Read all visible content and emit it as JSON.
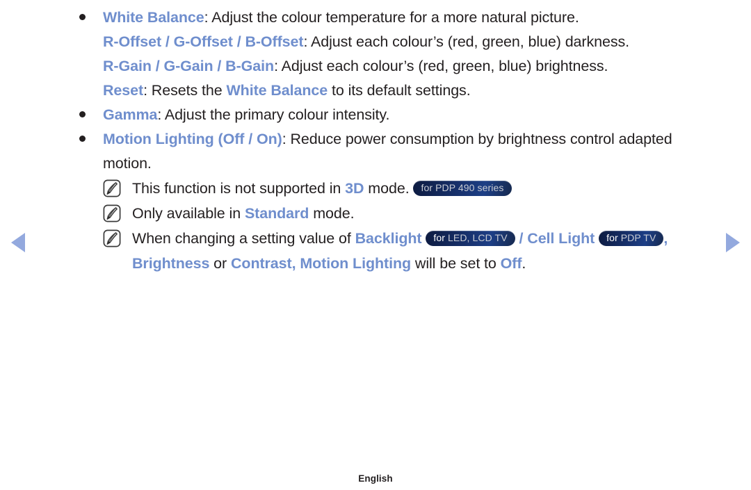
{
  "nav": {
    "prev_label": "previous page",
    "next_label": "next page"
  },
  "footer": {
    "language": "English"
  },
  "icons": {
    "note": "note-pencil-icon",
    "bullet": "bullet-dot-icon",
    "prev": "triangle-left-icon",
    "next": "triangle-right-icon"
  },
  "colors": {
    "accent_blue": "#6f8ecd",
    "nav_arrow": "#93a9de",
    "badge_navy": "#17306b",
    "text": "#231f20"
  },
  "body": {
    "items": [
      {
        "id": "white-balance",
        "bullet": true,
        "parts": [
          {
            "t": "White Balance",
            "s": "b"
          },
          {
            "t": ": Adjust the colour temperature for a more natural picture.",
            "s": "n"
          }
        ]
      },
      {
        "id": "offset",
        "bullet": false,
        "parts": [
          {
            "t": "R-Offset / G-Offset / B-Offset",
            "s": "b"
          },
          {
            "t": ": Adjust each colour’s (red, green, blue) darkness.",
            "s": "n"
          }
        ]
      },
      {
        "id": "gain",
        "bullet": false,
        "parts": [
          {
            "t": "R-Gain / G-Gain / B-Gain",
            "s": "b"
          },
          {
            "t": ": Adjust each colour’s (red, green, blue) brightness.",
            "s": "n"
          }
        ]
      },
      {
        "id": "reset",
        "bullet": false,
        "parts": [
          {
            "t": "Reset",
            "s": "b"
          },
          {
            "t": ": Resets the ",
            "s": "n"
          },
          {
            "t": "White Balance",
            "s": "b"
          },
          {
            "t": " to its default settings.",
            "s": "n"
          }
        ]
      },
      {
        "id": "gamma",
        "bullet": true,
        "parts": [
          {
            "t": "Gamma",
            "s": "b"
          },
          {
            "t": ": Adjust the primary colour intensity.",
            "s": "n"
          }
        ]
      },
      {
        "id": "motion-lighting",
        "bullet": true,
        "parts": [
          {
            "t": "Motion Lighting (Off / On)",
            "s": "b"
          },
          {
            "t": ": Reduce power consumption by brightness control adapted motion.",
            "s": "n"
          }
        ]
      }
    ],
    "notes": [
      {
        "id": "note-3d",
        "parts": [
          {
            "t": "This function is not supported in ",
            "s": "n"
          },
          {
            "t": "3D",
            "s": "b"
          },
          {
            "t": " mode. ",
            "s": "n"
          },
          {
            "t": "for PDP 490 series",
            "s": "pill",
            "pre": "",
            "hl": "for PDP 490 series"
          }
        ]
      },
      {
        "id": "note-standard",
        "parts": [
          {
            "t": "Only available in ",
            "s": "n"
          },
          {
            "t": "Standard",
            "s": "b"
          },
          {
            "t": " mode.",
            "s": "n"
          }
        ]
      },
      {
        "id": "note-backlight",
        "parts": [
          {
            "t": "When changing a setting value of ",
            "s": "n"
          },
          {
            "t": "Backlight",
            "s": "b"
          },
          {
            "t": " ",
            "s": "n"
          },
          {
            "t": "for LED, LCD TV",
            "s": "pill",
            "pre": "for ",
            "hl": "LED, LCD TV"
          },
          {
            "t": " ",
            "s": "n"
          },
          {
            "t": "/ Cell Light",
            "s": "b"
          },
          {
            "t": " ",
            "s": "n"
          },
          {
            "t": "for PDP TV",
            "s": "pill",
            "pre": "for ",
            "hl": "PDP TV"
          },
          {
            "t": ", ",
            "s": "b"
          },
          {
            "t": "Brightness",
            "s": "b"
          },
          {
            "t": " or ",
            "s": "n"
          },
          {
            "t": "Contrast",
            "s": "b"
          },
          {
            "t": ", ",
            "s": "b"
          },
          {
            "t": "Motion Lighting",
            "s": "b"
          },
          {
            "t": " will be set to ",
            "s": "n"
          },
          {
            "t": "Off",
            "s": "b"
          },
          {
            "t": ".",
            "s": "n"
          }
        ]
      }
    ]
  }
}
